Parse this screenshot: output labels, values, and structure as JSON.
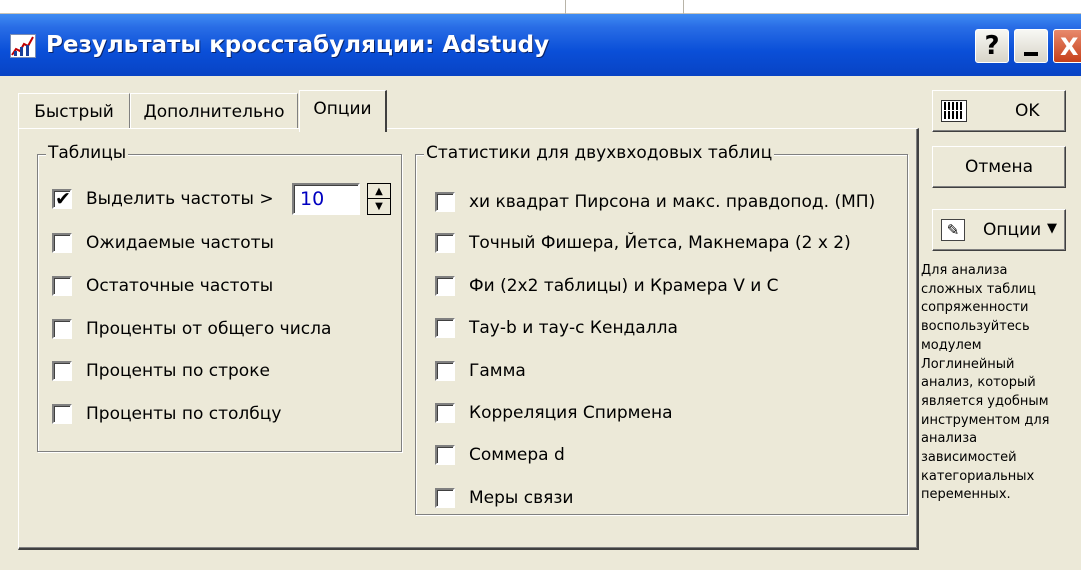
{
  "window": {
    "title": "Результаты кросстабуляции: Adstudy",
    "help_label": "?",
    "close_label": "X"
  },
  "tabs": [
    {
      "label": "Быстрый",
      "active": false
    },
    {
      "label": "Дополнительно",
      "active": false
    },
    {
      "label": "Опции",
      "active": true
    }
  ],
  "tables_group": {
    "legend": "Таблицы",
    "highlight": {
      "label": "Выделить частоты >",
      "checked": true,
      "value": "10"
    },
    "options": [
      {
        "label": "Ожидаемые частоты",
        "checked": false
      },
      {
        "label": "Остаточные частоты",
        "checked": false
      },
      {
        "label": "Проценты от общего числа",
        "checked": false
      },
      {
        "label": "Проценты по строке",
        "checked": false
      },
      {
        "label": "Проценты по столбцу",
        "checked": false
      }
    ]
  },
  "stats_group": {
    "legend": "Статистики для двухвходовых таблиц",
    "options": [
      {
        "label": "хи квадрат Пирсона и макс. правдопод. (МП)",
        "checked": false
      },
      {
        "label": "Точный Фишера, Йетса, Макнемара (2 x 2)",
        "checked": false
      },
      {
        "label": "Фи (2x2 таблицы) и Крамера V и  C",
        "checked": false
      },
      {
        "label": "Тау-b и тау-c Кендалла",
        "checked": false
      },
      {
        "label": "Гамма",
        "checked": false
      },
      {
        "label": "Корреляция Спирмена",
        "checked": false
      },
      {
        "label": "Соммера d",
        "checked": false
      },
      {
        "label": "Меры связи",
        "checked": false
      }
    ]
  },
  "buttons": {
    "ok": "OK",
    "cancel": "Отмена",
    "options": "Опции",
    "options_arrow": "▼"
  },
  "help_text": "Для анализа\nсложных таблиц\nсопряженности\nвоспользуйтесь\nмодулем\nЛоглинейный\nанализ, который\nявляется удобным\nинструментом для\nанализа\nзависимостей\nкатегориальных\nпеременных.",
  "checkmark": "✔"
}
